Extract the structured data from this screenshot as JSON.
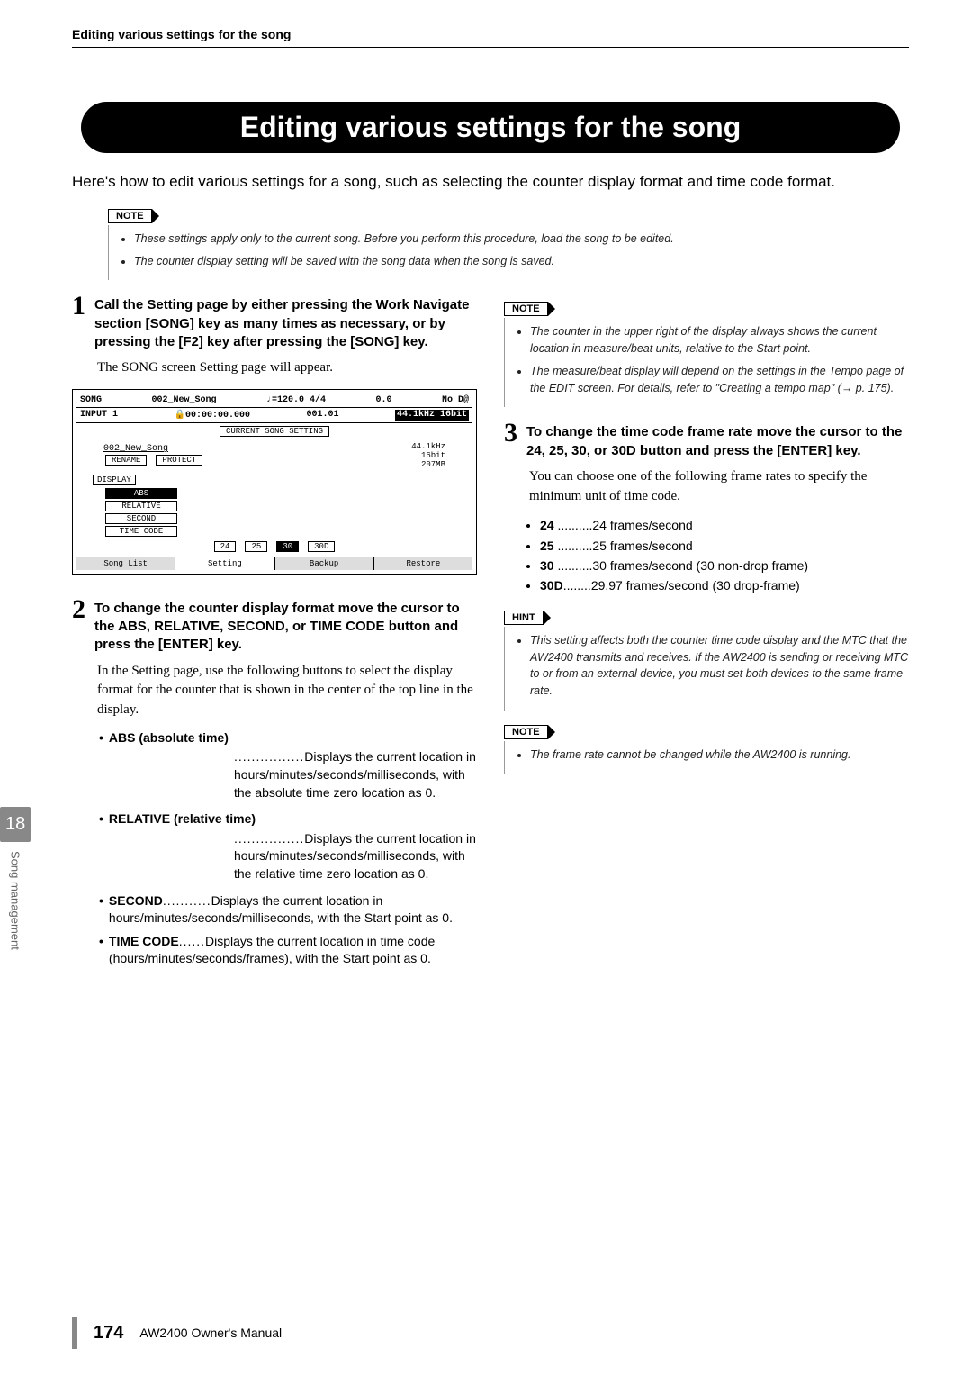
{
  "header": "Editing various settings for the song",
  "title": "Editing various settings for the song",
  "intro": "Here's how to edit various settings for a song, such as selecting the counter display format and time code format.",
  "topNote": {
    "label": "NOTE",
    "items": [
      "These settings apply only to the current song. Before you perform this procedure, load the song to be edited.",
      "The counter display setting will be saved with the song data when the song is saved."
    ]
  },
  "step1": {
    "num": "1",
    "title": "Call the Setting page by either pressing the Work Navigate section [SONG] key as many times as necessary, or by pressing the [F2] key after pressing the [SONG] key.",
    "body": "The SONG screen Setting page will appear."
  },
  "screenshot": {
    "topLeft": "SONG",
    "topMid": "002_New_Song",
    "topRightTempo": "♩=120.0   4/4",
    "topRightVal": "0.0",
    "topRightNo": "No D@",
    "subLeft": "INPUT 1",
    "subTime": "🔒00:00:00.000",
    "subMeas": "001.01",
    "subFmt": "44.1kHz  16bit",
    "sectionLabel": "CURRENT SONG SETTING",
    "songName": "002_New_Song",
    "rename": "RENAME",
    "protect": "PROTECT",
    "info1": "44.1kHz",
    "info2": "16bit",
    "info3": "207MB",
    "displayLabel": "DISPLAY",
    "abs": "ABS",
    "relative": "RELATIVE",
    "second": "SECOND",
    "timecode": "TIME CODE",
    "tc24": "24",
    "tc25": "25",
    "tc30": "30",
    "tc30d": "30D",
    "f1": "Song List",
    "f2": "Setting",
    "f3": "Backup",
    "f4": "Restore"
  },
  "step2": {
    "num": "2",
    "title": "To change the counter display format move the cursor to the ABS, RELATIVE, SECOND, or TIME CODE button and press the [ENTER] key.",
    "body": "In the Setting page, use the following buttons to select the display format for the counter that is shown in the center of the top line in the display.",
    "items": [
      {
        "term": "ABS (absolute time)",
        "dots": "................",
        "desc": "Displays the current location in hours/minutes/seconds/milliseconds, with the absolute time zero location as 0."
      },
      {
        "term": "RELATIVE (relative time)",
        "dots": "................",
        "desc": "Displays the current location in hours/minutes/seconds/milliseconds, with the relative time zero location as 0."
      },
      {
        "term": "SECOND",
        "dots": "...........",
        "desc": "Displays the current location in hours/minutes/seconds/milliseconds, with the Start point as 0."
      },
      {
        "term": "TIME CODE",
        "dots": "......",
        "desc": "Displays the current location in time code (hours/minutes/seconds/frames), with the Start point as 0."
      }
    ]
  },
  "rightNote": {
    "label": "NOTE",
    "items": [
      "The counter in the upper right of the display always shows the current location in measure/beat units, relative to the Start point.",
      "The measure/beat display will depend on the settings in the Tempo page of the EDIT screen. For details, refer to \"Creating a tempo map\" (→ p. 175)."
    ]
  },
  "step3": {
    "num": "3",
    "title": "To change the time code frame rate move the cursor to the 24, 25, 30, or 30D button and press the [ENTER] key.",
    "body": "You can choose one of the following frame rates to specify the minimum unit of time code.",
    "frameRates": [
      {
        "term": "24",
        "dots": " ..........",
        "desc": "24 frames/second"
      },
      {
        "term": "25",
        "dots": " ..........",
        "desc": "25 frames/second"
      },
      {
        "term": "30",
        "dots": " ..........",
        "desc": "30 frames/second (30 non-drop frame)"
      },
      {
        "term": "30D",
        "dots": "........",
        "desc": "29.97 frames/second (30 drop-frame)"
      }
    ]
  },
  "hint": {
    "label": "HINT",
    "items": [
      "This setting affects both the counter time code display and the MTC that the AW2400 transmits and receives. If the AW2400 is sending or receiving MTC to or from an external device, you must set both devices to the same frame rate."
    ]
  },
  "bottomNote": {
    "label": "NOTE",
    "items": [
      "The frame rate cannot be changed while the AW2400 is running."
    ]
  },
  "side": {
    "chapter": "18",
    "label": "Song management"
  },
  "footer": {
    "pageNum": "174",
    "manual": "AW2400  Owner's Manual"
  }
}
